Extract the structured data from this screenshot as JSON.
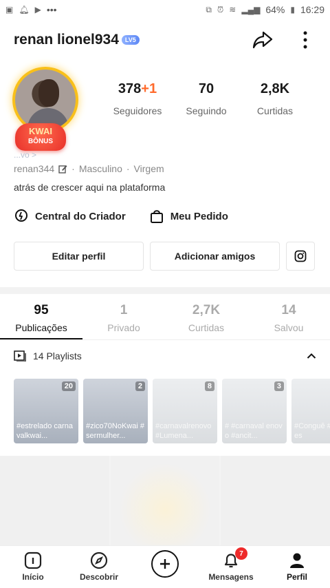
{
  "statusbar": {
    "battery": "64%",
    "time": "16:29",
    "dots": "•••"
  },
  "header": {
    "username": "renan lionel934",
    "level": "LV5"
  },
  "avatar": {
    "badge_line1": "KWAI",
    "badge_line2": "BÔNUS"
  },
  "stats": [
    {
      "value": "378",
      "plus": "+1",
      "label": "Seguidores"
    },
    {
      "value": "70",
      "plus": "",
      "label": "Seguindo"
    },
    {
      "value": "2,8K",
      "plus": "",
      "label": "Curtidas"
    }
  ],
  "faded_tag": "...vo >",
  "meta": {
    "handle": "renan344",
    "gender": "Masculino",
    "sign": "Virgem",
    "sep": "·"
  },
  "bio": "atrás de crescer aqui na plataforma",
  "links": {
    "creator": "Central do Criador",
    "orders": "Meu Pedido"
  },
  "buttons": {
    "edit": "Editar perfil",
    "add": "Adicionar amigos"
  },
  "tabs": [
    {
      "num": "95",
      "label": "Publicações"
    },
    {
      "num": "1",
      "label": "Privado"
    },
    {
      "num": "2,7K",
      "label": "Curtidas"
    },
    {
      "num": "14",
      "label": "Salvou"
    }
  ],
  "playlists": {
    "header": "14 Playlists",
    "items": [
      {
        "count": "20",
        "title": "#estrelado carnavalkwai..."
      },
      {
        "count": "2",
        "title": "#zico70NoKwai #sermulher..."
      },
      {
        "count": "8",
        "title": "#carnavalrenovo #Lumena..."
      },
      {
        "count": "3",
        "title": "# #carnaval enovo #ancit..."
      },
      {
        "count": "",
        "title": "#Conguê #Videntes"
      }
    ]
  },
  "nav": {
    "home": "Início",
    "discover": "Descobrir",
    "messages": "Mensagens",
    "profile": "Perfil",
    "badge": "7"
  }
}
